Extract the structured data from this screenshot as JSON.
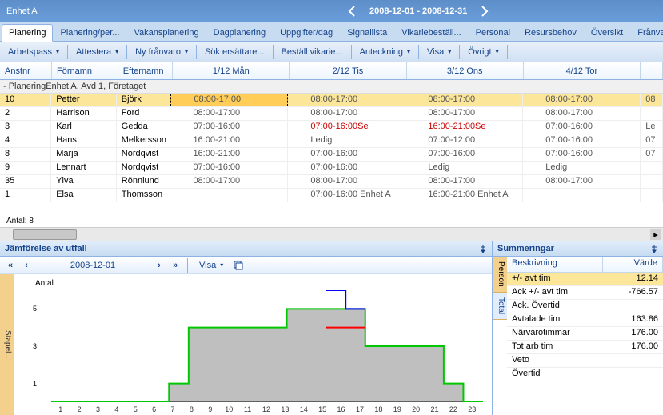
{
  "titlebar": {
    "unit": "Enhet A",
    "date_range": "2008-12-01 - 2008-12-31"
  },
  "tabs": [
    "Planering",
    "Planering/per...",
    "Vakansplanering",
    "Dagplanering",
    "Uppgifter/dag",
    "Signallista",
    "Vikariebeställ...",
    "Personal",
    "Resursbehov",
    "Översikt",
    "Frånvaroöver..."
  ],
  "active_tab": 0,
  "toolbar": [
    "Arbetspass",
    "Attestera",
    "Ny frånvaro",
    "Sök ersättare...",
    "Beställ vikarie...",
    "Anteckning",
    "Visa",
    "Övrigt"
  ],
  "toolbar_dd": [
    true,
    true,
    true,
    false,
    false,
    true,
    true,
    true
  ],
  "grid": {
    "columns": [
      "Anstnr",
      "Förnamn",
      "Efternamn",
      "1/12  Mån",
      "2/12  Tis",
      "3/12  Ons",
      "4/12  Tor",
      ""
    ],
    "group": "- PlaneringEnhet A, Avd 1, Företaget",
    "rows": [
      {
        "n": "10",
        "fn": "Petter",
        "en": "Björk",
        "d1": "08:00-17:00",
        "d2": "08:00-17:00",
        "d3": "08:00-17:00",
        "d4": "08:00-17:00",
        "d5": "08"
      },
      {
        "n": "2",
        "fn": "Harrison",
        "en": "Ford",
        "d1": "08:00-17:00",
        "d2": "08:00-17:00",
        "d3": "08:00-17:00",
        "d4": "08:00-17:00",
        "d5": ""
      },
      {
        "n": "3",
        "fn": "Karl",
        "en": "Gedda",
        "d1": "07:00-16:00",
        "d2": "07:00-16:00Se",
        "d2r": true,
        "d3": "16:00-21:00Se",
        "d3r": true,
        "d4": "07:00-16:00",
        "d5": "Le"
      },
      {
        "n": "4",
        "fn": "Hans",
        "en": "Melkersson",
        "d1": "16:00-21:00",
        "d2": "Ledig",
        "d3": "07:00-12:00",
        "d4": "07:00-16:00",
        "d5": "07"
      },
      {
        "n": "8",
        "fn": "Marja",
        "en": "Nordqvist",
        "d1": "16:00-21:00",
        "d2": "07:00-16:00",
        "d3": "07:00-16:00",
        "d4": "07:00-16:00",
        "d5": "07"
      },
      {
        "n": "9",
        "fn": "Lennart",
        "en": "Nordqvist",
        "d1": "07:00-16:00",
        "d2": "07:00-16:00",
        "d3": "Ledig",
        "d4": "Ledig",
        "d5": ""
      },
      {
        "n": "35",
        "fn": "Ylva",
        "en": "Rönnlund",
        "d1": "08:00-17:00",
        "d2": "08:00-17:00",
        "d3": "08:00-17:00",
        "d4": "08:00-17:00",
        "d5": ""
      },
      {
        "n": "1",
        "fn": "Elsa",
        "en": "Thomsson",
        "d1": "",
        "d2": "07:00-16:00 Enhet A",
        "d3": "16:00-21:00 Enhet A",
        "d4": "",
        "d5": ""
      }
    ],
    "footer_label": "Antal: 8"
  },
  "chart_panel": {
    "title": "Jämförelse av utfall",
    "nav_date": "2008-12-01",
    "visa": "Visa",
    "side_tab": "Stapel...",
    "ylabel": "Antal"
  },
  "chart_data": {
    "type": "line",
    "x": [
      1,
      2,
      3,
      4,
      5,
      6,
      7,
      8,
      9,
      10,
      11,
      12,
      13,
      14,
      15,
      16,
      17,
      18,
      19,
      20,
      21,
      22,
      23
    ],
    "series": [
      {
        "name": "filled",
        "color": "#bdbdbd",
        "values": [
          0,
          0,
          0,
          0,
          0,
          0,
          1,
          4,
          4,
          4,
          4,
          4,
          5,
          5,
          5,
          5,
          3,
          3,
          3,
          3,
          1,
          0,
          0
        ]
      },
      {
        "name": "green",
        "color": "#00c800",
        "values": [
          0,
          0,
          0,
          0,
          0,
          0,
          1,
          4,
          4,
          4,
          4,
          4,
          5,
          5,
          5,
          5,
          3,
          3,
          3,
          3,
          1,
          0,
          0
        ]
      },
      {
        "name": "blue",
        "color": "#0000ff",
        "values": [
          null,
          null,
          null,
          null,
          null,
          null,
          null,
          null,
          null,
          null,
          null,
          null,
          null,
          null,
          6,
          5,
          null,
          null,
          null,
          null,
          null,
          null,
          null
        ]
      },
      {
        "name": "red",
        "color": "#ff0000",
        "values": [
          null,
          null,
          null,
          null,
          null,
          null,
          null,
          null,
          null,
          null,
          null,
          null,
          null,
          null,
          4,
          4,
          null,
          null,
          null,
          null,
          null,
          null,
          null
        ]
      }
    ],
    "y_ticks": [
      1,
      3,
      5
    ],
    "ylim": [
      0,
      6
    ],
    "xlim": [
      1,
      23
    ]
  },
  "summary_panel": {
    "title": "Summeringar",
    "side_tabs": [
      "Person",
      "Total"
    ],
    "active_side": 0,
    "columns": [
      "Beskrivning",
      "Värde"
    ],
    "rows": [
      {
        "k": "+/- avt tim",
        "v": "12.14"
      },
      {
        "k": "Ack +/- avt tim",
        "v": "-766.57"
      },
      {
        "k": "Ack. Övertid",
        "v": ""
      },
      {
        "k": "Avtalade tim",
        "v": "163.86"
      },
      {
        "k": "Närvarotimmar",
        "v": "176.00"
      },
      {
        "k": "Tot arb tim",
        "v": "176.00"
      },
      {
        "k": "Veto",
        "v": ""
      },
      {
        "k": "Övertid",
        "v": ""
      }
    ]
  }
}
